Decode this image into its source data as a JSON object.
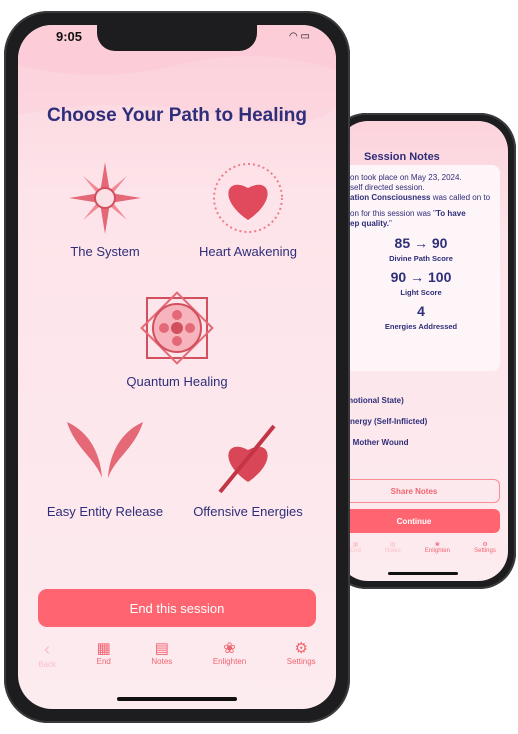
{
  "front": {
    "status_time": "9:05",
    "title": "Choose Your Path to Healing",
    "options": [
      {
        "label": "The System",
        "icon": "sun-star-icon"
      },
      {
        "label": "Heart Awakening",
        "icon": "radiant-heart-icon"
      },
      {
        "label": "Quantum Healing",
        "icon": "sacred-geometry-icon"
      },
      {
        "label": "Easy Entity Release",
        "icon": "angel-wings-icon"
      },
      {
        "label": "Offensive Energies",
        "icon": "pierced-heart-icon"
      }
    ],
    "end_button": "End this session",
    "tabs": [
      {
        "label": "Back",
        "icon": "chevron-left-icon",
        "disabled": true
      },
      {
        "label": "End",
        "icon": "checkered-flag-icon"
      },
      {
        "label": "Notes",
        "icon": "notebook-icon"
      },
      {
        "label": "Enlighten",
        "icon": "lotus-icon"
      },
      {
        "label": "Settings",
        "icon": "gear-icon"
      }
    ]
  },
  "back": {
    "title": "Session Notes",
    "notes_lines": [
      "on took place on May 23, 2024.",
      "self directed session."
    ],
    "notes_bold_1": "ation Consciousness",
    "notes_rest_1": " was called on to",
    "notes_intent": "on for this session was \"",
    "notes_intent_bold": "To have",
    "notes_intent_bold2": "ep quality.",
    "notes_intent_end": "\"",
    "scores": [
      {
        "value": "85 → 90",
        "label": "Divine Path Score"
      },
      {
        "value": "90 → 100",
        "label": "Light Score"
      },
      {
        "value": "4",
        "label": "Energies Addressed"
      }
    ],
    "energies": [
      "(Emotional State)",
      "e Energy (Self-Inflicted)",
      "nd: Mother Wound"
    ],
    "share_button": "Share Notes",
    "continue_button": "Continue",
    "tabs": [
      {
        "label": "End",
        "disabled": true
      },
      {
        "label": "Notes",
        "disabled": true
      },
      {
        "label": "Enlighten"
      },
      {
        "label": "Settings"
      }
    ]
  },
  "colors": {
    "accent": "#fe6570",
    "navy": "#2f2e7a",
    "background": "#fde4ea"
  }
}
